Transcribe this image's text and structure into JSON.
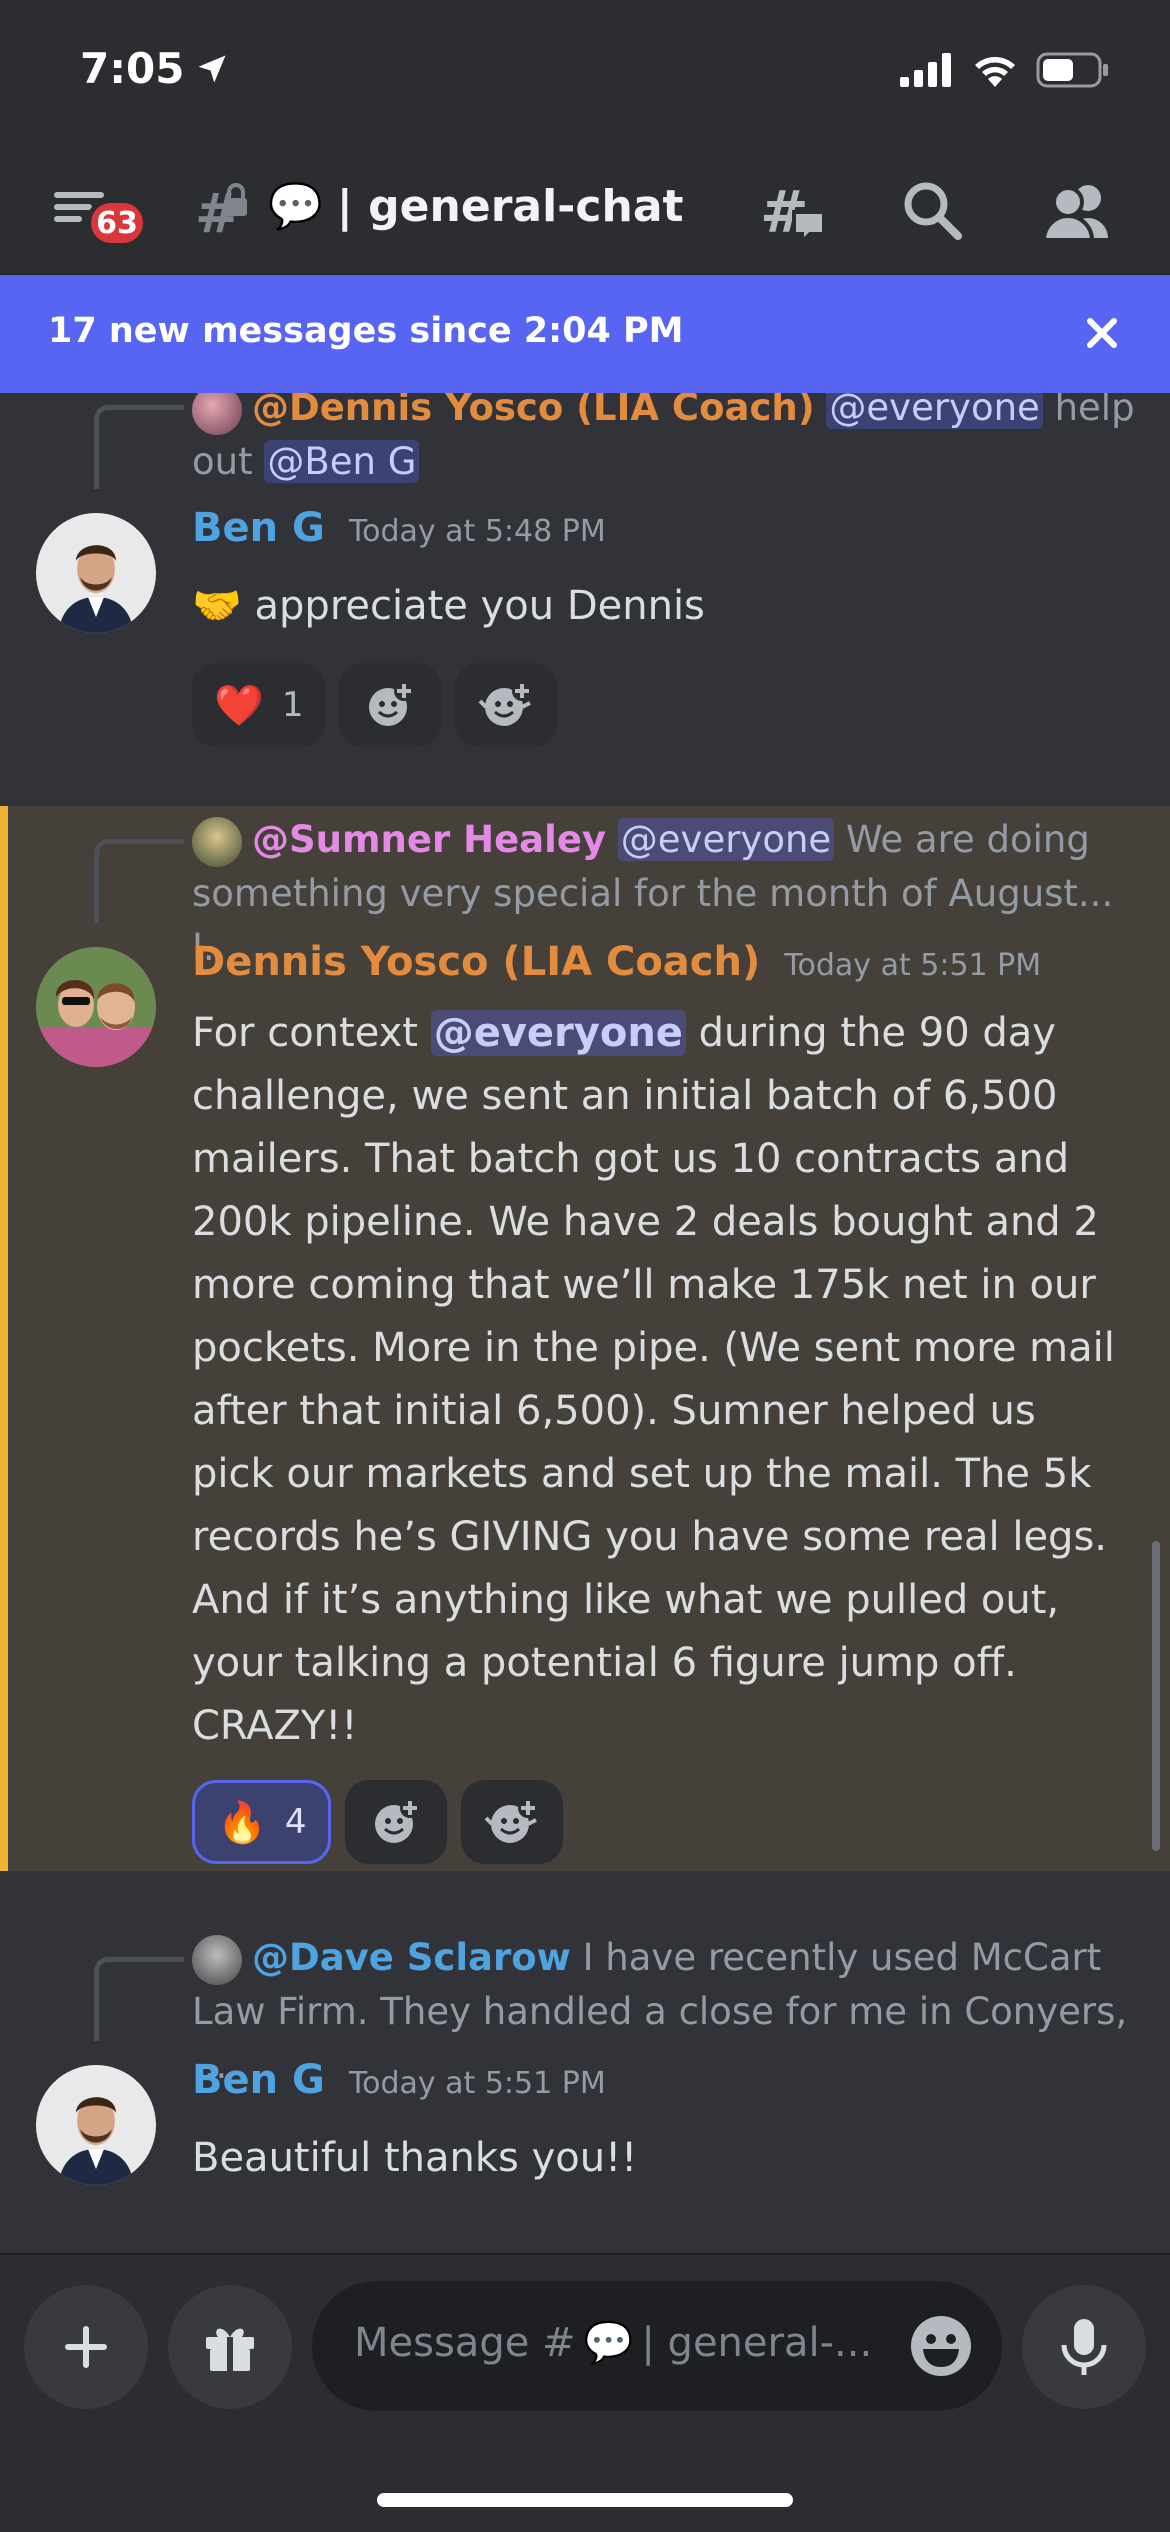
{
  "status_bar": {
    "time": "7:05"
  },
  "header": {
    "unread_badge": "63",
    "channel_prefix": "💬",
    "channel_name": "| general-chat"
  },
  "banner": {
    "text": "17 new messages since 2:04 PM"
  },
  "messages": [
    {
      "reply": {
        "name": "@Dennis Yosco (LIA Coach)",
        "mention": "@everyone",
        "text": "help out",
        "mention2": "@Ben G"
      },
      "author": "Ben G",
      "timestamp": "Today at 5:48 PM",
      "text": "🤝 appreciate you Dennis",
      "reactions": [
        {
          "emoji": "❤️",
          "count": "1"
        }
      ]
    },
    {
      "reply": {
        "name": "@Sumner Healey",
        "mention": "@everyone",
        "text": "We are doing something very special for the month of August... I..."
      },
      "author": "Dennis Yosco (LIA Coach)",
      "timestamp": "Today at 5:51 PM",
      "text_before": "For context ",
      "mention": "@everyone",
      "text_after": " during the 90 day challenge, we sent an initial batch of 6,500 mailers. That batch got us 10 contracts and 200k pipeline. We have 2 deals bought and 2 more coming that we’ll make 175k net in our pockets. More in the pipe. (We sent more mail after that initial 6,500). Sumner helped us pick our markets and set up the mail. The 5k records he’s GIVING you have some real legs. And if it’s anything like what we pulled out, your talking a potential 6 figure jump off. CRAZY!!",
      "reactions": [
        {
          "emoji": "🔥",
          "count": "4"
        }
      ]
    },
    {
      "reply": {
        "name": "@Dave Sclarow",
        "text": "I have recently used McCart Law Firm. They handled a close for me in Conyers, ..."
      },
      "author": "Ben G",
      "timestamp": "Today at 5:51 PM",
      "text": "Beautiful thanks you!!"
    }
  ],
  "composer": {
    "placeholder_prefix": "Message #",
    "placeholder_emoji": "💬",
    "placeholder_suffix": "| general-..."
  },
  "colors": {
    "accent": "#5865f2",
    "ben_name": "#4fa3e0",
    "dennis_name": "#e38b3f",
    "sumner_name": "#e589e6",
    "dave_name": "#4fa3e0",
    "highlight_bar": "#f0b232"
  }
}
